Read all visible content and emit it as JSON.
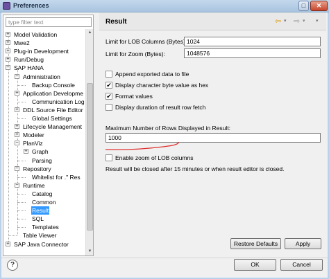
{
  "window": {
    "title": "Preferences",
    "maximize_glyph": "□",
    "close_glyph": "✕"
  },
  "filter": {
    "placeholder": "type filter text",
    "value": ""
  },
  "tree": [
    {
      "label": "Model Validation",
      "expander": "+"
    },
    {
      "label": "Mwe2",
      "expander": "+"
    },
    {
      "label": "Plug-in Development",
      "expander": "+"
    },
    {
      "label": "Run/Debug",
      "expander": "+"
    },
    {
      "label": "SAP HANA",
      "expander": "−"
    },
    {
      "label": "Administration",
      "expander": "−"
    },
    {
      "label": "Backup Console",
      "expander": ""
    },
    {
      "label": "Application Developme",
      "expander": "+"
    },
    {
      "label": "Communication Log",
      "expander": ""
    },
    {
      "label": "DDL Source File Editor",
      "expander": "+"
    },
    {
      "label": "Global Settings",
      "expander": ""
    },
    {
      "label": "Lifecycle Management",
      "expander": "+"
    },
    {
      "label": "Modeler",
      "expander": "+"
    },
    {
      "label": "PlanViz",
      "expander": "−"
    },
    {
      "label": "Graph",
      "expander": "+"
    },
    {
      "label": "Parsing",
      "expander": ""
    },
    {
      "label": "Repository",
      "expander": "−"
    },
    {
      "label": "Whitelist for .\" Res",
      "expander": ""
    },
    {
      "label": "Runtime",
      "expander": "−"
    },
    {
      "label": "Catalog",
      "expander": ""
    },
    {
      "label": "Common",
      "expander": ""
    },
    {
      "label": "Result",
      "expander": ""
    },
    {
      "label": "SQL",
      "expander": ""
    },
    {
      "label": "Templates",
      "expander": ""
    },
    {
      "label": "Table Viewer",
      "expander": ""
    },
    {
      "label": "SAP Java Connector",
      "expander": "+"
    }
  ],
  "scrollbar": {
    "up": "▲",
    "down": "▼"
  },
  "page": {
    "title": "Result",
    "nav": {
      "back": "⇦",
      "back_dropdown": "▾",
      "forward": "⇨",
      "forward_dropdown": "▾",
      "menu": "▾"
    },
    "lob_columns": {
      "label": "Limit for LOB Columns (Bytes):",
      "value": "1024"
    },
    "zoom": {
      "label": "Limit for Zoom (Bytes):",
      "value": "1048576"
    },
    "checkboxes": [
      {
        "label": "Append exported data to file",
        "checked": false
      },
      {
        "label": "Display character byte value as hex",
        "checked": true
      },
      {
        "label": "Format values",
        "checked": true
      },
      {
        "label": "Display duration of result row fetch",
        "checked": false
      }
    ],
    "max_rows": {
      "label": "Maximum Number of Rows Displayed in Result:",
      "value": "1000"
    },
    "zoom_lob": {
      "label": "Enable zoom of LOB columns",
      "checked": false
    },
    "info": "Result will be closed after 15 minutes or when result editor is closed.",
    "restore_defaults": "Restore Defaults",
    "apply": "Apply"
  },
  "footer": {
    "help": "?",
    "ok": "OK",
    "cancel": "Cancel"
  },
  "colors": {
    "selection": "#3399ff",
    "annotation_ink": "#e03030"
  }
}
